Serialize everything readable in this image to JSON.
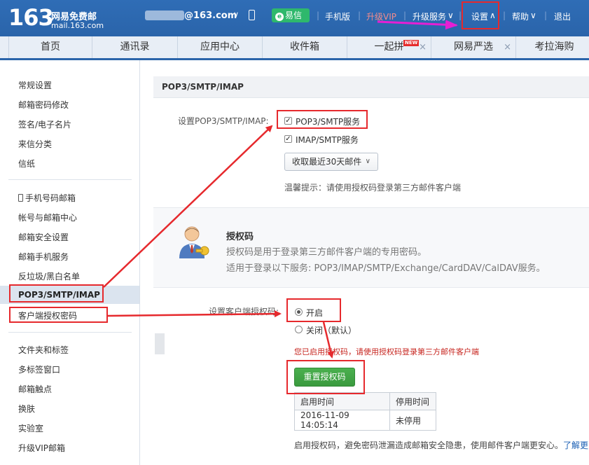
{
  "header": {
    "logo_number": "163",
    "logo_name": "网易免费邮",
    "logo_domain": "mail.163.com",
    "account": "@163.com",
    "yixin": "易信",
    "links": [
      "手机版",
      "升级VIP",
      "升级服务",
      "设置",
      "帮助",
      "退出"
    ]
  },
  "nav": {
    "tabs": [
      "首页",
      "通讯录",
      "应用中心",
      "收件箱",
      "一起拼",
      "网易严选",
      "考拉海购"
    ],
    "new_badge": "NEW"
  },
  "sidebar": {
    "group1": [
      "常规设置",
      "邮箱密码修改",
      "签名/电子名片",
      "来信分类",
      "信纸"
    ],
    "group2": [
      "手机号码邮箱",
      "帐号与邮箱中心",
      "邮箱安全设置",
      "邮箱手机服务",
      "反垃圾/黑白名单",
      "POP3/SMTP/IMAP",
      "客户端授权密码"
    ],
    "group3": [
      "文件夹和标签",
      "多标签窗口",
      "邮箱触点",
      "换肤",
      "实验室",
      "升级VIP邮箱"
    ]
  },
  "main": {
    "panel_title": "POP3/SMTP/IMAP",
    "setting_label": "设置POP3/SMTP/IMAP:",
    "pop3_label": "POP3/SMTP服务",
    "imap_label": "IMAP/SMTP服务",
    "fetch_select": "收取最近30天邮件",
    "tip": "温馨提示：请使用授权码登录第三方邮件客户端",
    "auth_title": "授权码",
    "auth_desc1": "授权码是用于登录第三方邮件客户端的专用密码。",
    "auth_desc2": "适用于登录以下服务: POP3/IMAP/SMTP/Exchange/CardDAV/CalDAV服务。",
    "client_auth_label": "设置客户端授权码:",
    "radio_on": "开启",
    "radio_off": "关闭（默认）",
    "warning": "您已启用授权码，请使用授权码登录第三方邮件客户端",
    "reset_button": "重置授权码",
    "table_headers": [
      "启用时间",
      "停用时间"
    ],
    "table_row": [
      "2016-11-09 14:05:14",
      "未停用"
    ],
    "footer_text": "启用授权码，避免密码泄漏造成邮箱安全隐患，使用邮件客户端更安心。",
    "footer_link": "了解更"
  }
}
